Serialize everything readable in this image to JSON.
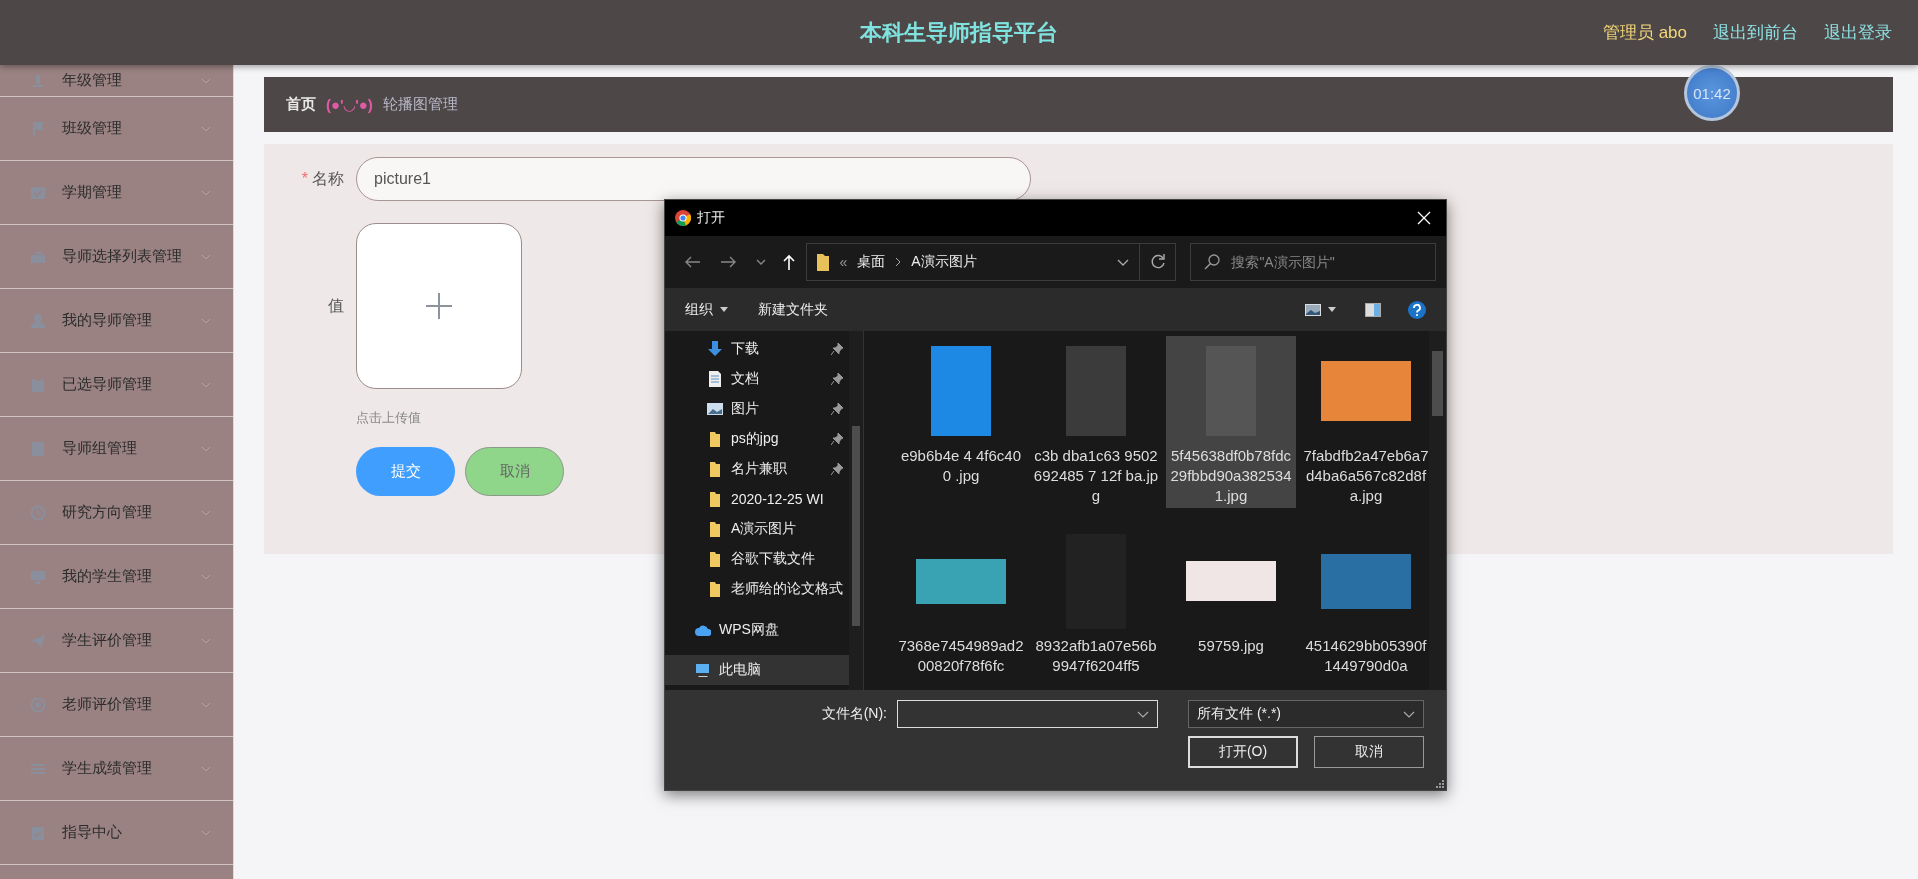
{
  "header": {
    "title": "本科生导师指导平台",
    "user": "管理员 abo",
    "links": [
      "退出到前台",
      "退出登录"
    ]
  },
  "sidebar": {
    "items": [
      {
        "label": "年级管理"
      },
      {
        "label": "班级管理"
      },
      {
        "label": "学期管理"
      },
      {
        "label": "导师选择列表管理"
      },
      {
        "label": "我的导师管理"
      },
      {
        "label": "已选导师管理"
      },
      {
        "label": "导师组管理"
      },
      {
        "label": "研究方向管理"
      },
      {
        "label": "我的学生管理"
      },
      {
        "label": "学生评价管理"
      },
      {
        "label": "老师评价管理"
      },
      {
        "label": "学生成绩管理"
      },
      {
        "label": "指导中心"
      }
    ]
  },
  "breadcrumb": {
    "home": "首页",
    "emoticon": "(●'◡'●)",
    "current": "轮播图管理"
  },
  "timer": "01:42",
  "form": {
    "fields": [
      {
        "kind": "text",
        "label": "名称",
        "required_mark": "*",
        "value": "picture1"
      },
      {
        "kind": "upload",
        "label": "值",
        "hint": "点击上传值"
      }
    ],
    "buttons": [
      {
        "kind": "primary",
        "label": "提交"
      },
      {
        "kind": "secondary",
        "label": "取消"
      }
    ]
  },
  "dialog": {
    "title": "打开",
    "path": {
      "overflow": "«",
      "segments": [
        "桌面",
        "A演示图片"
      ]
    },
    "search": {
      "placeholder": "搜索\"A演示图片\""
    },
    "toolbar": {
      "organize": "组织",
      "new_folder": "新建文件夹"
    },
    "nav": [
      {
        "kind": "download",
        "label": "下载",
        "pinned": true
      },
      {
        "kind": "document",
        "label": "文档",
        "pinned": true
      },
      {
        "kind": "pictures",
        "label": "图片",
        "pinned": true
      },
      {
        "kind": "folder",
        "label": "ps的jpg",
        "pinned": true
      },
      {
        "kind": "folder",
        "label": "名片兼职",
        "pinned": true
      },
      {
        "kind": "folder",
        "label": "2020-12-25 WI",
        "pinned": false
      },
      {
        "kind": "folder",
        "label": "A演示图片",
        "pinned": false
      },
      {
        "kind": "folder",
        "label": "谷歌下载文件",
        "pinned": false
      },
      {
        "kind": "folder",
        "label": "老师给的论文格式",
        "pinned": false
      }
    ],
    "locations": [
      {
        "kind": "cloud",
        "label": "WPS网盘",
        "selected": false
      },
      {
        "kind": "computer",
        "label": "此电脑",
        "selected": true
      }
    ],
    "files": [
      {
        "name": "e9b6b4e 4 4f6c400 .jpg",
        "selected": false
      },
      {
        "name": "c3b dba1c63 9502692485 7 12f ba.jpg",
        "selected": false
      },
      {
        "name": "5f45638df0b78fdc29fbbd90a3825341.jpg",
        "selected": true
      },
      {
        "name": "7fabdfb2a47eb6a7d4ba6a567c82d8fa.jpg",
        "selected": false
      },
      {
        "name": "7368e7454989ad200820f78f6fc",
        "selected": false
      },
      {
        "name": "8932afb1a07e56b9947f6204ff5",
        "selected": false
      },
      {
        "name": "59759.jpg",
        "selected": false
      },
      {
        "name": "4514629bb05390f1449790d0a",
        "selected": false
      }
    ],
    "filename": {
      "label": "文件名(N):"
    },
    "filetype": "所有文件 (*.*)",
    "buttons": [
      "打开(O)",
      "取消"
    ]
  }
}
